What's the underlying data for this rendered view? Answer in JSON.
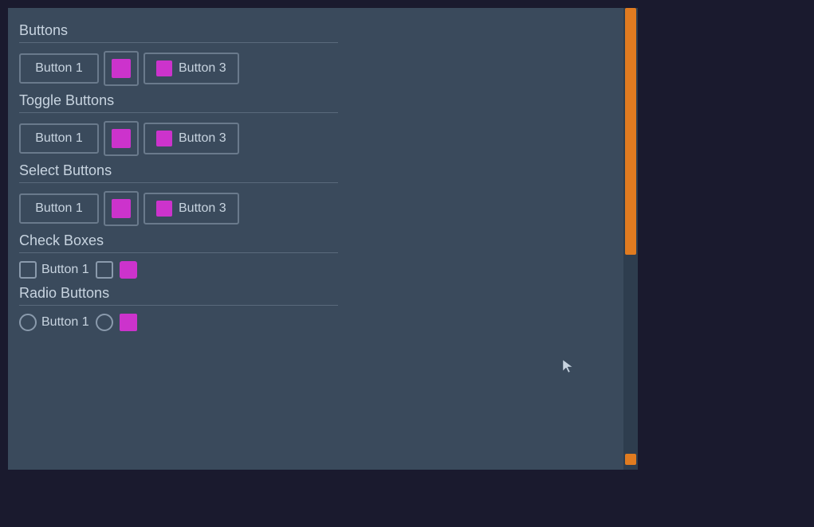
{
  "colors": {
    "background": "#3a4a5c",
    "text": "#c8d4e0",
    "border": "#6a7a8c",
    "accent_purple": "#cc33cc",
    "accent_orange": "#e07b20",
    "scrollbar_bg": "#2e3d4e"
  },
  "sections": [
    {
      "id": "buttons",
      "title": "Buttons",
      "type": "buttons",
      "items": [
        {
          "label": "Button 1",
          "type": "text"
        },
        {
          "label": "",
          "type": "icon"
        },
        {
          "label": "Button 3",
          "type": "icon-text"
        }
      ]
    },
    {
      "id": "toggle-buttons",
      "title": "Toggle Buttons",
      "type": "buttons",
      "items": [
        {
          "label": "Button 1",
          "type": "text"
        },
        {
          "label": "",
          "type": "icon"
        },
        {
          "label": "Button 3",
          "type": "icon-text"
        }
      ]
    },
    {
      "id": "select-buttons",
      "title": "Select Buttons",
      "type": "buttons",
      "items": [
        {
          "label": "Button 1",
          "type": "text"
        },
        {
          "label": "",
          "type": "icon"
        },
        {
          "label": "Button 3",
          "type": "icon-text"
        }
      ]
    },
    {
      "id": "check-boxes",
      "title": "Check Boxes",
      "type": "checkboxes",
      "items": [
        {
          "label": "Button 1",
          "checked": false
        },
        {
          "label": "",
          "checked": false
        },
        {
          "label": "",
          "checked": true,
          "icon": true
        }
      ]
    },
    {
      "id": "radio-buttons",
      "title": "Radio Buttons",
      "type": "radio",
      "items": [
        {
          "label": "Button 1",
          "selected": false
        },
        {
          "label": "",
          "selected": false
        },
        {
          "label": "",
          "selected": true,
          "icon": true
        }
      ]
    }
  ],
  "scrollbar": {
    "thumb_color": "#e07b20",
    "indicator_color": "#e07b20"
  }
}
